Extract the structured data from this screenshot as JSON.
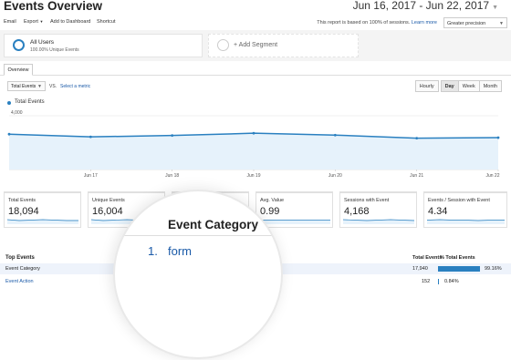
{
  "header": {
    "title": "Events Overview",
    "date_range": "Jun 16, 2017 - Jun 22, 2017"
  },
  "toolbar": {
    "items": [
      "Email",
      "Export",
      "Add to Dashboard",
      "Shortcut"
    ],
    "report_note": "This report is based on 100% of sessions.",
    "learn_more": "Learn more",
    "precision": "Greater precision"
  },
  "segments": [
    {
      "name": "All Users",
      "sub": "100.00% Unique Events"
    },
    {
      "name": "+ Add Segment"
    }
  ],
  "tabs": [
    "Overview"
  ],
  "chart_controls": {
    "metric": "Total Events",
    "vs": "VS.",
    "select_metric": "Select a metric",
    "granularity": [
      "Hourly",
      "Day",
      "Week",
      "Month"
    ],
    "active_granularity": "Day"
  },
  "chart_data": {
    "type": "area",
    "series": [
      {
        "name": "Total Events",
        "color": "#2a80c0",
        "values": [
          2630,
          2430,
          2530,
          2700,
          2560,
          2330,
          2370
        ]
      }
    ],
    "x": [
      "Jun 16",
      "Jun 17",
      "Jun 18",
      "Jun 19",
      "Jun 20",
      "Jun 21",
      "Jun 22"
    ],
    "x_tick_labels": [
      "Jun 17",
      "Jun 18",
      "Jun 19",
      "Jun 20",
      "Jun 21",
      "Jun 22"
    ],
    "y_tick_labels": [
      "4,000",
      "2,000"
    ],
    "ylim": [
      0,
      4000
    ],
    "grid": true
  },
  "metrics": [
    {
      "label": "Total Events",
      "value": "18,094"
    },
    {
      "label": "Unique Events",
      "value": "16,004"
    },
    {
      "label": "",
      "value": ""
    },
    {
      "label": "Avg. Value",
      "value": "0.99"
    },
    {
      "label": "Sessions with Event",
      "value": "4,168"
    },
    {
      "label": "Events / Session with Event",
      "value": "4.34"
    }
  ],
  "table": {
    "title": "Top Events",
    "col_total": "Total Events",
    "col_pct": "% Total Events",
    "rows": [
      {
        "label": "Event Category",
        "total": "17,940",
        "pct": "99.16%",
        "pct_value": 0.9916
      },
      {
        "label": "Event Action",
        "total": "152",
        "pct": "0.84%",
        "pct_value": 0.0084
      }
    ]
  },
  "magnifier": {
    "heading": "Event Category",
    "row_num": "1.",
    "row_link": "form"
  },
  "colors": {
    "accent": "#2a80c0",
    "link": "#1a5aa8",
    "area_fill": "#e6f2fb"
  }
}
